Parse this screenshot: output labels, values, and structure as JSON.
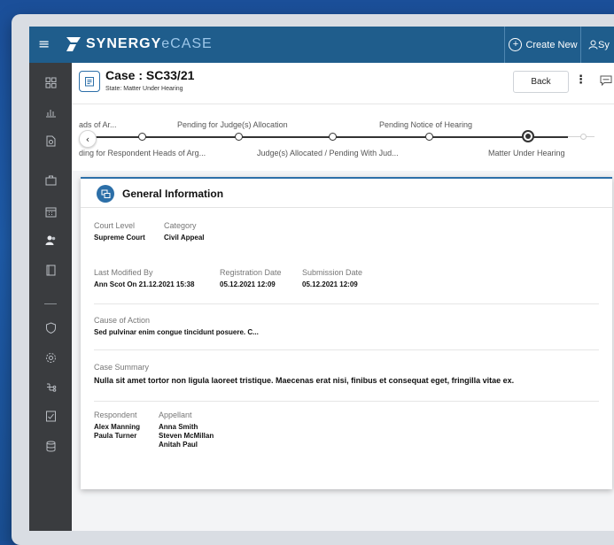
{
  "topbar": {
    "menu_icon": "hamburger-icon",
    "logo_bold": "SYNERGY",
    "logo_light": "eCASE",
    "create_new_label": "Create New",
    "user_label": "Sy"
  },
  "sidebar": {
    "icons": [
      "dashboard-icon",
      "chart-icon",
      "document-search-icon",
      "briefcase-icon",
      "calendar-icon",
      "users-icon",
      "book-icon",
      "shield-icon",
      "settings-icon",
      "hierarchy-icon",
      "checklist-icon",
      "database-icon"
    ]
  },
  "header": {
    "case_title": "Case : SC33/21",
    "case_state": "State: Matter Under Hearing",
    "back_label": "Back"
  },
  "progress": {
    "top_steps": [
      "ads of Ar...",
      "Pending for Judge(s) Allocation",
      "Pending Notice of Hearing"
    ],
    "bottom_steps": [
      "ding for Respondent Heads of Arg...",
      "Judge(s) Allocated / Pending With Jud...",
      "Matter Under Hearing"
    ]
  },
  "general_info": {
    "title": "General Information",
    "court_level_label": "Court Level",
    "court_level": "Supreme Court",
    "category_label": "Category",
    "category": "Civil Appeal",
    "last_modified_label": "Last Modified By",
    "last_modified": "Ann Scot On 21.12.2021 15:38",
    "registration_label": "Registration Date",
    "registration": "05.12.2021 12:09",
    "submission_label": "Submission Date",
    "submission": "05.12.2021 12:09",
    "cause_label": "Cause of Action",
    "cause": "Sed pulvinar enim congue tincidunt posuere. C...",
    "summary_label": "Case Summary",
    "summary": "Nulla sit amet tortor non ligula laoreet tristique. Maecenas erat nisi, finibus et consequat eget, fringilla vitae ex.",
    "respondent_label": "Respondent",
    "respondents": [
      "Alex Manning",
      "Paula Turner"
    ],
    "appellant_label": "Appellant",
    "appellants": [
      "Anna Smith",
      "Steven McMillan",
      "Anitah Paul"
    ]
  },
  "colors": {
    "topbar": "#1f5d8c",
    "sidebar": "#3a3c3f",
    "accent": "#2c6fa8",
    "background": "#1e5ba8"
  }
}
